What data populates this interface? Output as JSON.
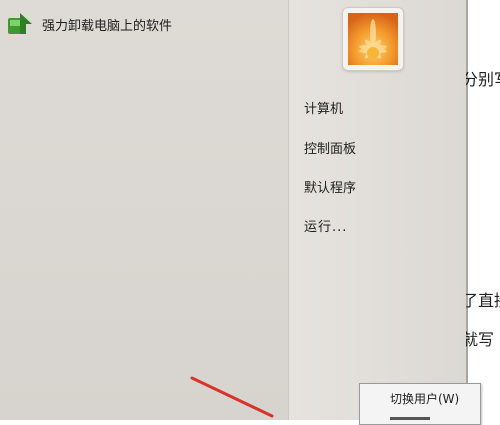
{
  "start_menu": {
    "programs": [
      {
        "label": "强力卸载电脑上的软件",
        "icon": "uninstaller-icon"
      }
    ],
    "places": {
      "computer": "计算机",
      "control_panel": "控制面板",
      "default_programs": "默认程序",
      "run": "运行..."
    },
    "user_picture": "flower-user-picture",
    "shutdown_submenu": {
      "switch_user": "切换用户(W)"
    }
  },
  "background_document": {
    "line1": "分别写",
    "line2": "了直接",
    "line3": "就写"
  },
  "colors": {
    "annotation_arrow": "#d9342b"
  }
}
